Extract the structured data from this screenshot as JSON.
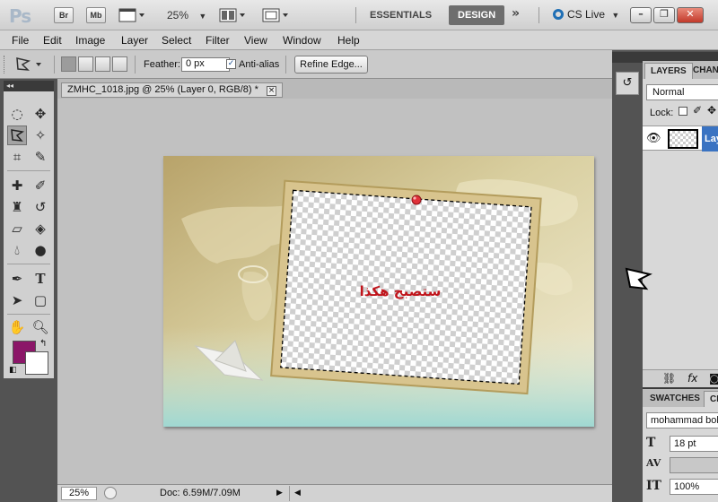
{
  "appbar": {
    "logo": "Ps",
    "bridge_label": "Br",
    "minibridge_label": "Mb",
    "zoom": "25%",
    "workspaces": [
      "ESSENTIALS",
      "DESIGN"
    ],
    "more": "»",
    "cslive": "CS Live"
  },
  "menu": [
    "File",
    "Edit",
    "Image",
    "Layer",
    "Select",
    "Filter",
    "View",
    "Window",
    "Help"
  ],
  "options": {
    "feather_label": "Feather:",
    "feather_value": "0 px",
    "antialias_label": "Anti-alias",
    "antialias_checked": true,
    "refine_label": "Refine Edge..."
  },
  "tools": {
    "panel_title": "◂◂",
    "foreground_color": "#8b1668",
    "background_color": "#ffffff"
  },
  "document": {
    "tab_title": "ZMHC_1018.jpg @ 25% (Layer 0, RGB/8) *",
    "tab_close": "×",
    "overlay_text": "ستصبح هكذا",
    "overlay_color": "#c0141b",
    "status_zoom": "25%",
    "status_doc": "Doc: 6.59M/7.09M"
  },
  "panels": {
    "layers_tabs": [
      "LAYERS",
      "CHAN"
    ],
    "blend_mode": "Normal",
    "lock_label": "Lock:",
    "layer_name": "Lay",
    "character_tabs": [
      "SWATCHES",
      "CH"
    ],
    "font_family": "mohammad bold",
    "font_size": "18 pt",
    "tracking": "",
    "scale": "100%"
  },
  "accent_color": "#3a73c2"
}
